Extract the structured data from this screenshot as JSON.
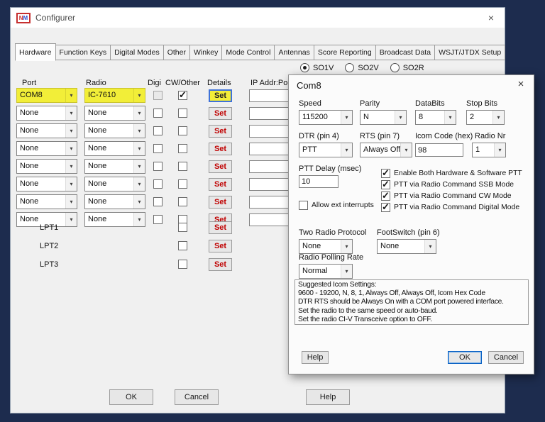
{
  "icons": {
    "chevron": "▾",
    "close": "×",
    "check": "✓"
  },
  "window": {
    "title": "Configurer",
    "icon": {
      "n": "N",
      "m": "M"
    }
  },
  "tabs": [
    {
      "label": "Hardware",
      "selected": true
    },
    {
      "label": "Function Keys",
      "selected": false
    },
    {
      "label": "Digital Modes",
      "selected": false
    },
    {
      "label": "Other",
      "selected": false
    },
    {
      "label": "Winkey",
      "selected": false
    },
    {
      "label": "Mode Control",
      "selected": false
    },
    {
      "label": "Antennas",
      "selected": false
    },
    {
      "label": "Score Reporting",
      "selected": false
    },
    {
      "label": "Broadcast Data",
      "selected": false
    },
    {
      "label": "WSJT/JTDX Setup",
      "selected": false
    }
  ],
  "modes": [
    {
      "label": "SO1V",
      "selected": true
    },
    {
      "label": "SO2V",
      "selected": false
    },
    {
      "label": "SO2R",
      "selected": false
    }
  ],
  "grid": {
    "headers": {
      "port": "Port",
      "radio": "Radio",
      "digi": "Digi",
      "cw_other": "CW/Other",
      "details": "Details",
      "ip": "IP Addr:Port"
    },
    "set_label": "Set",
    "com_rows": [
      {
        "port": "COM8",
        "radio": "IC-7610",
        "digi": false,
        "cw_other": true
      },
      {
        "port": "None",
        "radio": "None",
        "digi": false,
        "cw_other": false
      },
      {
        "port": "None",
        "radio": "None",
        "digi": false,
        "cw_other": false
      },
      {
        "port": "None",
        "radio": "None",
        "digi": false,
        "cw_other": false
      },
      {
        "port": "None",
        "radio": "None",
        "digi": false,
        "cw_other": false
      },
      {
        "port": "None",
        "radio": "None",
        "digi": false,
        "cw_other": false
      },
      {
        "port": "None",
        "radio": "None",
        "digi": false,
        "cw_other": false
      },
      {
        "port": "None",
        "radio": "None",
        "digi": false,
        "cw_other": false
      }
    ],
    "lpt_rows": [
      {
        "label": "LPT1",
        "checked": false
      },
      {
        "label": "LPT2",
        "checked": false
      },
      {
        "label": "LPT3",
        "checked": false
      }
    ]
  },
  "footer": {
    "ok": "OK",
    "cancel": "Cancel",
    "help": "Help"
  },
  "com8": {
    "title": "Com8",
    "speed": {
      "label": "Speed",
      "value": "115200"
    },
    "parity": {
      "label": "Parity",
      "value": "N"
    },
    "databits": {
      "label": "DataBits",
      "value": "8"
    },
    "stopbits": {
      "label": "Stop Bits",
      "value": "2"
    },
    "dtr": {
      "label": "DTR (pin 4)",
      "value": "PTT"
    },
    "rts": {
      "label": "RTS (pin 7)",
      "value": "Always Off"
    },
    "icom_code": {
      "label": "Icom Code (hex)",
      "value": "98"
    },
    "radio_nr": {
      "label": "Radio Nr",
      "value": "1"
    },
    "ptt_delay": {
      "label": "PTT Delay  (msec)",
      "value": "10"
    },
    "allow_ext": {
      "label": "Allow ext interrupts",
      "checked": false
    },
    "ptt_checks": [
      {
        "label": "Enable Both Hardware & Software PTT",
        "checked": true
      },
      {
        "label": "PTT via Radio Command SSB Mode",
        "checked": true
      },
      {
        "label": "PTT via Radio Command CW Mode",
        "checked": true
      },
      {
        "label": "PTT via Radio Command Digital Mode",
        "checked": true
      }
    ],
    "two_radio": {
      "label": "Two Radio Protocol",
      "value": "None"
    },
    "footswitch": {
      "label": "FootSwitch (pin 6)",
      "value": "None"
    },
    "polling": {
      "label": "Radio Polling Rate",
      "value": "Normal"
    },
    "suggested_lines": [
      "Suggested Icom Settings:",
      "9600 - 19200,  N,  8,  1,  Always Off, Always Off,  Icom Hex Code",
      "DTR  RTS should be Always On with a COM port powered interface.",
      "Set the radio to the same speed or auto-baud.",
      "Set the radio CI-V Transceive option to OFF."
    ],
    "buttons": {
      "help": "Help",
      "ok": "OK",
      "cancel": "Cancel"
    }
  }
}
